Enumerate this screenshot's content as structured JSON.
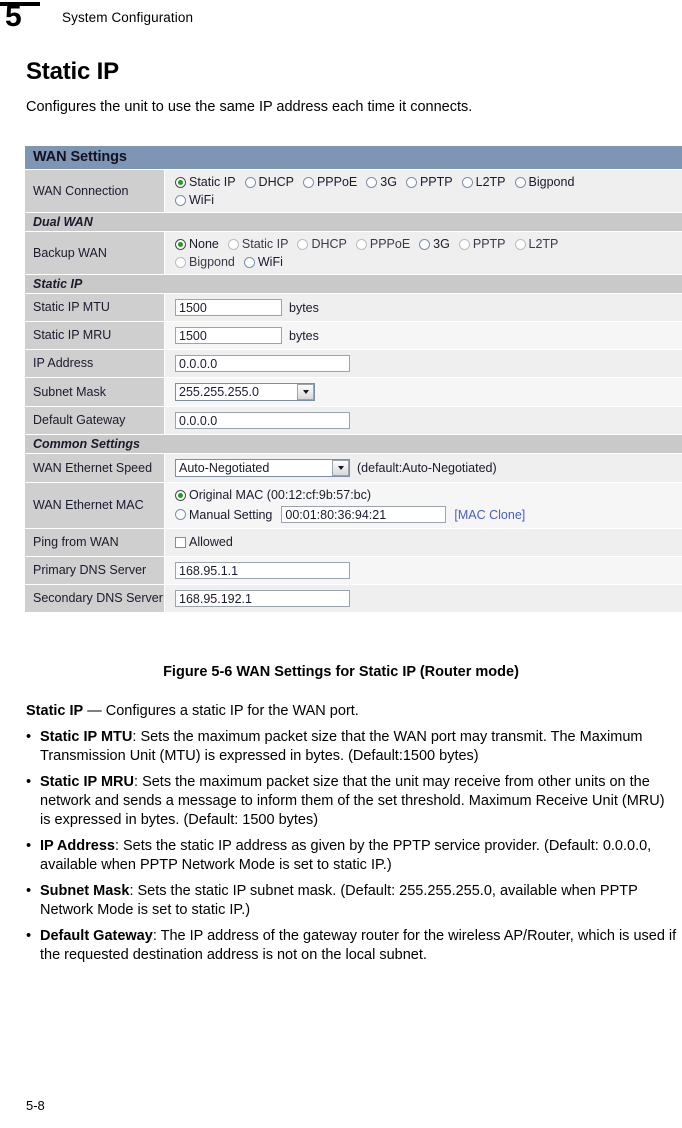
{
  "runhead": {
    "chapter_number": "5",
    "title": "System Configuration"
  },
  "page": {
    "heading": "Static IP",
    "intro": "Configures the unit to use the same IP address each time it connects.",
    "folio": "5-8"
  },
  "figure": {
    "caption": "Figure 5-6  WAN Settings for Static IP (Router mode)",
    "titlebar": "WAN Settings",
    "sections": {
      "dual_wan": "Dual WAN",
      "static_ip": "Static IP",
      "common_settings": "Common Settings"
    },
    "wan_connection": {
      "label": "WAN Connection",
      "selected": "Static IP",
      "options_row1": [
        "Static IP",
        "DHCP",
        "PPPoE",
        "3G",
        "PPTP",
        "L2TP",
        "Bigpond"
      ],
      "options_row2": [
        "WiFi"
      ]
    },
    "backup_wan": {
      "label": "Backup WAN",
      "selected": "None",
      "options_row1": [
        "None",
        "Static IP",
        "DHCP",
        "PPPoE",
        "3G",
        "PPTP",
        "L2TP"
      ],
      "options_row2": [
        "Bigpond",
        "WiFi"
      ]
    },
    "static_ip_mtu": {
      "label": "Static IP MTU",
      "value": "1500",
      "units": "bytes"
    },
    "static_ip_mru": {
      "label": "Static IP MRU",
      "value": "1500",
      "units": "bytes"
    },
    "ip_address": {
      "label": "IP Address",
      "value": "0.0.0.0"
    },
    "subnet_mask": {
      "label": "Subnet Mask",
      "value": "255.255.255.0"
    },
    "default_gateway": {
      "label": "Default Gateway",
      "value": "0.0.0.0"
    },
    "wan_ethernet_speed": {
      "label": "WAN Ethernet Speed",
      "value": "Auto-Negotiated",
      "note": "(default:Auto-Negotiated)"
    },
    "wan_ethernet_mac": {
      "label": "WAN Ethernet MAC",
      "original_label": "Original MAC (00:12:cf:9b:57:bc)",
      "manual_label": "Manual Setting",
      "manual_value": "00:01:80:36:94:21",
      "clone_link": "[MAC Clone]",
      "selected": "Original MAC"
    },
    "ping_from_wan": {
      "label": "Ping from WAN",
      "checkbox_label": "Allowed",
      "checked": false
    },
    "primary_dns": {
      "label": "Primary DNS Server",
      "value": "168.95.1.1"
    },
    "secondary_dns": {
      "label": "Secondary DNS Server",
      "value": "168.95.192.1"
    },
    "colors": {
      "titlebar": "#7e96b3",
      "section_band": "#c9c9c9",
      "label_cell": "#cfcfcf",
      "row": "#efefef",
      "link": "#4a5bd0",
      "radio_dot": "#19a019"
    }
  },
  "body": {
    "lead_bold": "Static IP",
    "lead_rest": " — Configures a static IP for the WAN port.",
    "bullets": [
      {
        "term": "Static IP MTU",
        "text": ": Sets the maximum packet size that the WAN port may transmit. The Maximum Transmission Unit (MTU) is expressed in bytes. (Default:1500 bytes)"
      },
      {
        "term": "Static IP MRU",
        "text": ": Sets the maximum packet size that the unit may receive from other units on the network and sends a message to inform them of the set threshold. Maximum Receive Unit (MRU) is expressed in bytes. (Default: 1500 bytes)"
      },
      {
        "term": "IP Address",
        "text": ": Sets the static IP address as given by the PPTP service provider. (Default: 0.0.0.0, available when PPTP Network Mode is set to static IP.)"
      },
      {
        "term": "Subnet Mask",
        "text": ": Sets the static IP subnet mask. (Default: 255.255.255.0, available when PPTP Network Mode is set to static IP.)"
      },
      {
        "term": "Default Gateway",
        "text": ": The IP address of the gateway router for the wireless AP/Router, which is used if the requested destination address is not on the local subnet."
      }
    ]
  }
}
